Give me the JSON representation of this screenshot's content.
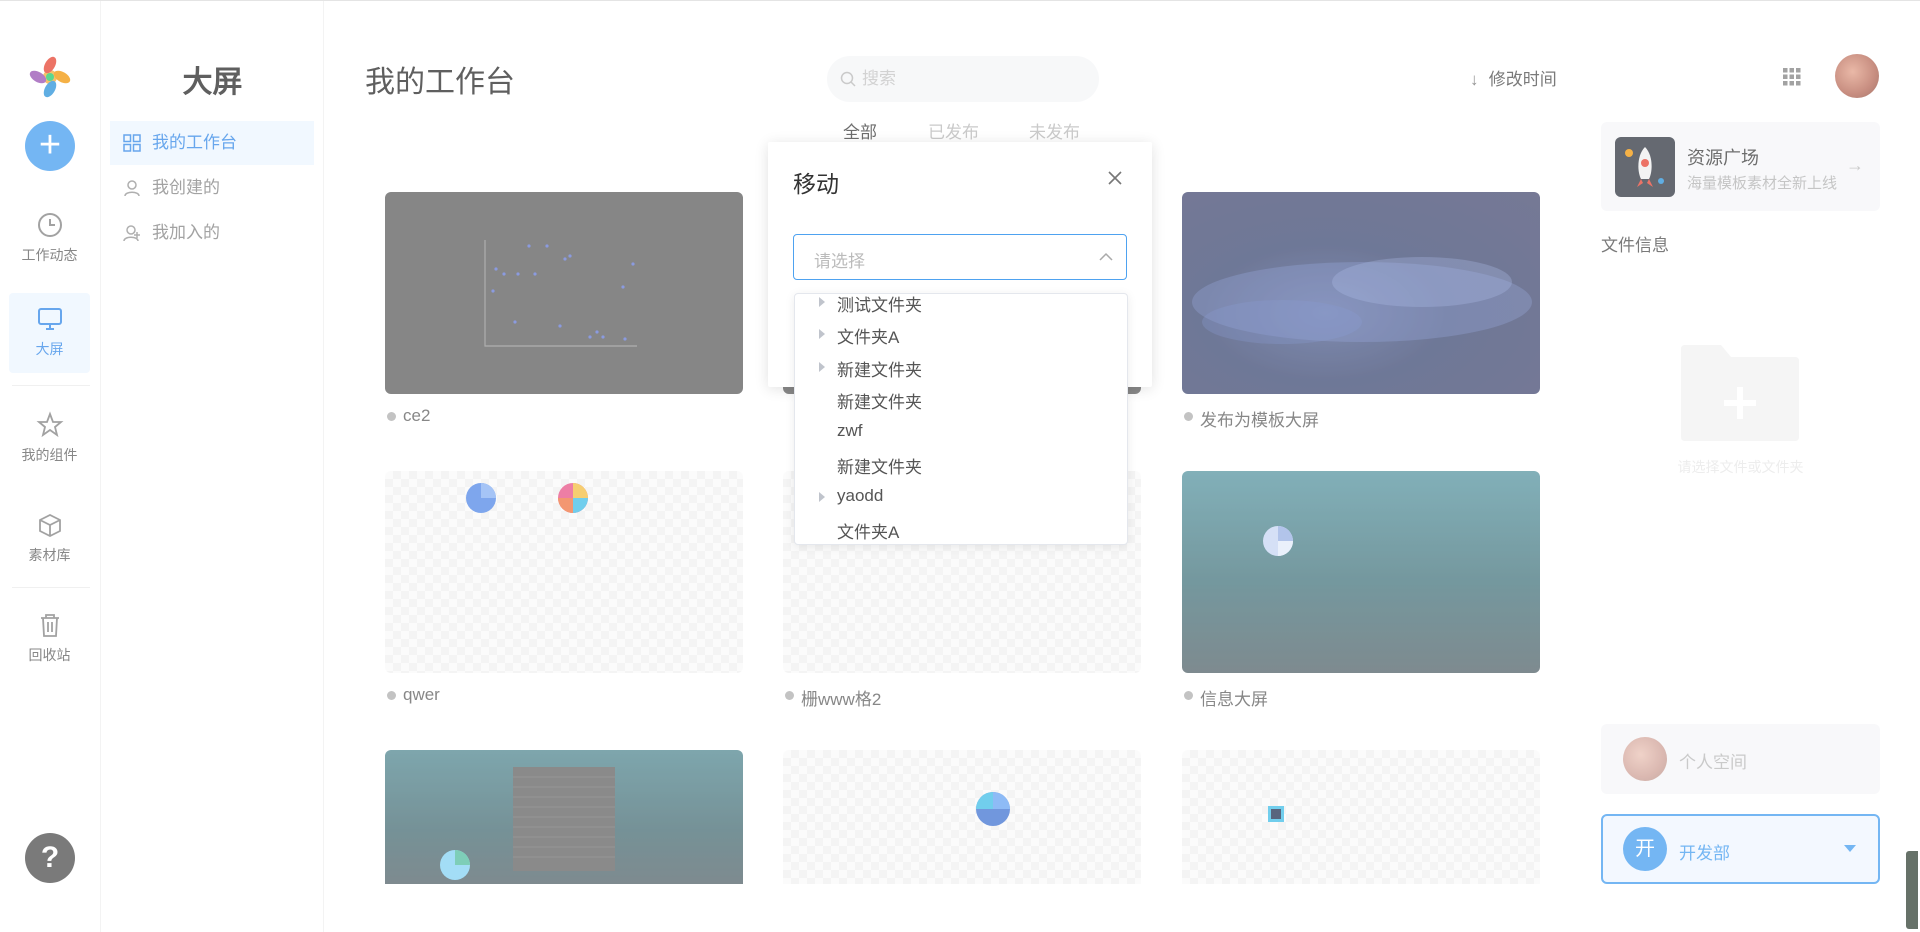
{
  "sidebar": {
    "items": [
      {
        "label": "工作动态",
        "icon": "clock-icon"
      },
      {
        "label": "大屏",
        "icon": "monitor-icon",
        "active": true
      },
      {
        "label": "我的组件",
        "icon": "star-icon"
      },
      {
        "label": "素材库",
        "icon": "box-icon"
      },
      {
        "label": "回收站",
        "icon": "trash-icon"
      }
    ],
    "add_icon": "plus-icon",
    "help_label": "?"
  },
  "nav": {
    "title": "大屏",
    "items": [
      {
        "label": "我的工作台",
        "icon": "grid-icon",
        "active": true
      },
      {
        "label": "我创建的",
        "icon": "user-icon"
      },
      {
        "label": "我加入的",
        "icon": "users-icon"
      }
    ]
  },
  "header": {
    "title": "我的工作台",
    "search_placeholder": "搜索",
    "sort_label": "修改时间",
    "tabs": [
      "全部",
      "已发布",
      "未发布"
    ]
  },
  "cards": [
    {
      "label": "ce2"
    },
    {
      "label": ""
    },
    {
      "label": "发布为模板大屏"
    },
    {
      "label": "qwer"
    },
    {
      "label": "栅www格2"
    },
    {
      "label": "信息大屏"
    },
    {
      "label": ""
    },
    {
      "label": ""
    },
    {
      "label": ""
    }
  ],
  "right_panel": {
    "resource_title": "资源广场",
    "resource_subtitle": "海量模板素材全新上线",
    "file_info_label": "文件信息",
    "empty_tip": "请选择文件或文件夹",
    "personal_space": "个人空间",
    "team_avatar": "开",
    "team_name": "开发部"
  },
  "modal": {
    "title": "移动",
    "select_placeholder": "请选择",
    "tree": [
      {
        "label": "测试文件夹",
        "expandable": true
      },
      {
        "label": "文件夹A",
        "expandable": true
      },
      {
        "label": "新建文件夹",
        "expandable": true
      },
      {
        "label": "新建文件夹",
        "expandable": false
      },
      {
        "label": "zwf",
        "expandable": false
      },
      {
        "label": "新建文件夹",
        "expandable": false
      },
      {
        "label": "yaodd",
        "expandable": true
      },
      {
        "label": "文件夹A",
        "expandable": false
      }
    ]
  },
  "colors": {
    "accent": "#4ea2f0",
    "active_bg": "#eef6ff"
  }
}
